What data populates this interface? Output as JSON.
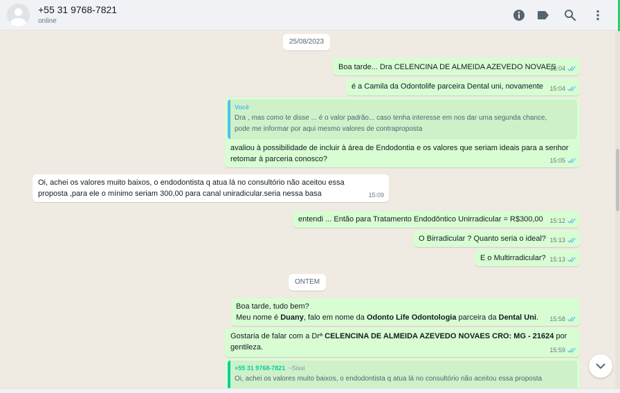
{
  "header": {
    "contact_name": "+55 31 9768-7821",
    "status": "online",
    "icons": [
      "info-icon",
      "label-icon",
      "search-icon",
      "menu-icon"
    ]
  },
  "chat": {
    "date_separators": [
      "25/08/2023",
      "ONTEM"
    ],
    "messages": [
      {
        "dir": "out",
        "text": "Boa tarde... Dra CELENCINA DE ALMEIDA AZEVEDO NOVAES",
        "time": "15:04",
        "status": "read"
      },
      {
        "dir": "out",
        "text": "é a Camila da Odontolife parceira Dental uni, novamente",
        "time": "15:04",
        "status": "read"
      },
      {
        "dir": "out",
        "quote": {
          "author": "Você",
          "lines": [
            "Dra , mas como te disse ... é o valor padrão... caso tenha interesse em nos dar uma segunda chance,",
            "pode me informar por aqui mesmo valores de contraproposta"
          ]
        },
        "lines": [
          "avaliou à possibilidade de incluir à área de Endodontia e os valores que seriam ideais para a senhor",
          "retomar à parceria conosco?"
        ],
        "time": "15:05",
        "status": "read"
      },
      {
        "dir": "in",
        "lines": [
          "Oi, achei os valores muito baixos, o endodontista q atua lá no consultório não aceitou essa",
          "proposta ,para ele o mínimo seriam 300,00 para canal uniradicular.seria nessa basa"
        ],
        "time": "15:09"
      },
      {
        "dir": "out",
        "text": "entendi ... Então para Tratamento Endodôntico Unirradicular = R$300,00",
        "time": "15:12",
        "status": "read"
      },
      {
        "dir": "out",
        "text": "O Birradicular ? Quanto seria o ideal?",
        "time": "15:13",
        "status": "read"
      },
      {
        "dir": "out",
        "text": "E o Multirradicular?",
        "time": "15:13",
        "status": "read"
      },
      {
        "dir": "out",
        "line1": "Boa tarde, tudo bem?",
        "line2": {
          "t1": "Meu nome é ",
          "b1": "Duany",
          "t2": ", falo em nome da ",
          "b2": "Odonto Life Odontologia",
          "t3": " parceira da ",
          "b3": "Dental Uni",
          "t4": "."
        },
        "time": "15:58",
        "status": "read"
      },
      {
        "dir": "out",
        "line1": {
          "t1": "Gostaria de falar com a Drª ",
          "b1": "CELENCINA DE ALMEIDA AZEVEDO NOVAES CRO: MG - 21624",
          "t2": " por"
        },
        "line2": "gentileza.",
        "time": "15:59",
        "status": "read"
      },
      {
        "dir": "out",
        "quote": {
          "author": "+55 31 9768-7821",
          "pushname": "~Sissi",
          "line": "Oi, achei os valores muito baixos, o endodontista q atua lá no consultório não aceitou essa proposta"
        }
      }
    ]
  },
  "colors": {
    "outgoing_bubble": "#d9fdd3",
    "incoming_bubble": "#ffffff",
    "chat_background": "#efeae2",
    "read_ticks": "#53bdeb",
    "quote_self": "#53bdeb",
    "quote_contact": "#06cf9c"
  }
}
